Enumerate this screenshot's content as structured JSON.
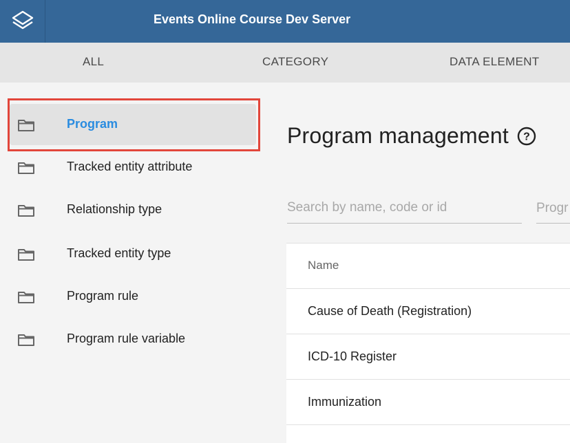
{
  "header": {
    "title": "Events Online Course Dev Server",
    "logo_icon": "dhis2-logo-icon",
    "background": "#356798"
  },
  "tabs": [
    {
      "label": "ALL"
    },
    {
      "label": "CATEGORY"
    },
    {
      "label": "DATA ELEMENT"
    }
  ],
  "sidebar": {
    "items": [
      {
        "label": "Program",
        "icon": "folder-icon",
        "active": true
      },
      {
        "label": "Tracked entity attribute",
        "icon": "folder-icon"
      },
      {
        "label": "Relationship type",
        "icon": "folder-icon"
      },
      {
        "label": "Tracked entity type",
        "icon": "folder-icon"
      },
      {
        "label": "Program rule",
        "icon": "folder-icon"
      },
      {
        "label": "Program rule variable",
        "icon": "folder-icon"
      }
    ],
    "active_color": "#2a8ce0",
    "highlight_color": "#e2463b"
  },
  "main": {
    "title": "Program management",
    "help_icon": "help-circle-icon",
    "search": {
      "placeholder": "Search by name, code or id",
      "value": ""
    },
    "type_filter_label": "Progr",
    "table": {
      "header": "Name",
      "rows": [
        "Cause of Death (Registration)",
        "ICD-10 Register",
        "Immunization"
      ]
    }
  }
}
